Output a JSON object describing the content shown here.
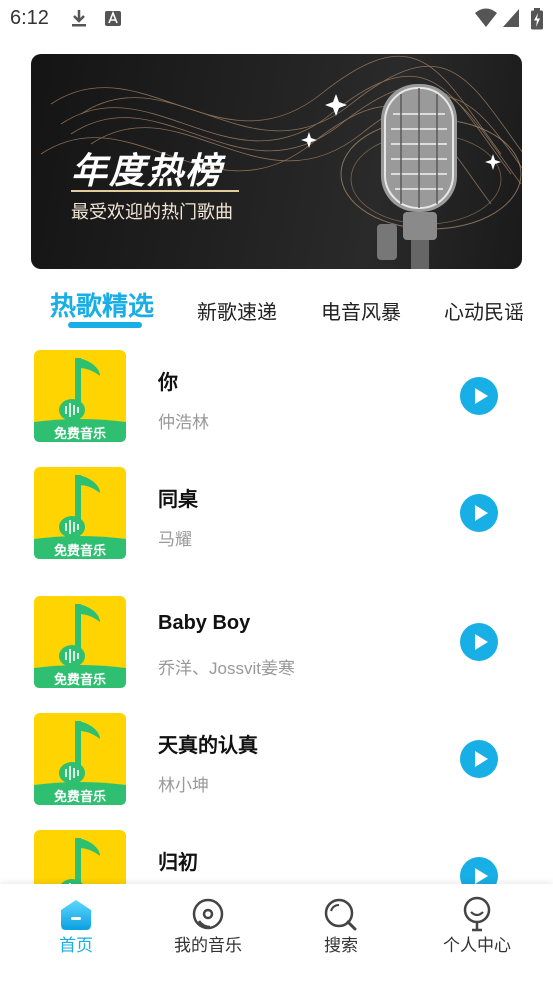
{
  "status_bar": {
    "time": "6:12"
  },
  "banner": {
    "title": "年度热榜",
    "subtitle": "最受欢迎的热门歌曲"
  },
  "tabs": [
    "热歌精选",
    "新歌速递",
    "电音风暴",
    "心动民谣"
  ],
  "cover_label": "免费音乐",
  "songs": [
    {
      "title": "你",
      "artist": "仲浩林"
    },
    {
      "title": "同桌",
      "artist": "马耀"
    },
    {
      "title": "Baby Boy",
      "artist": "乔洋、Jossvit姜寒"
    },
    {
      "title": "天真的认真",
      "artist": "林小坤"
    },
    {
      "title": "归初",
      "artist": ""
    }
  ],
  "nav": [
    "首页",
    "我的音乐",
    "搜索",
    "个人中心"
  ],
  "colors": {
    "accent": "#18aee6",
    "cover_yellow": "#ffd400",
    "cover_green": "#2fbf71"
  }
}
